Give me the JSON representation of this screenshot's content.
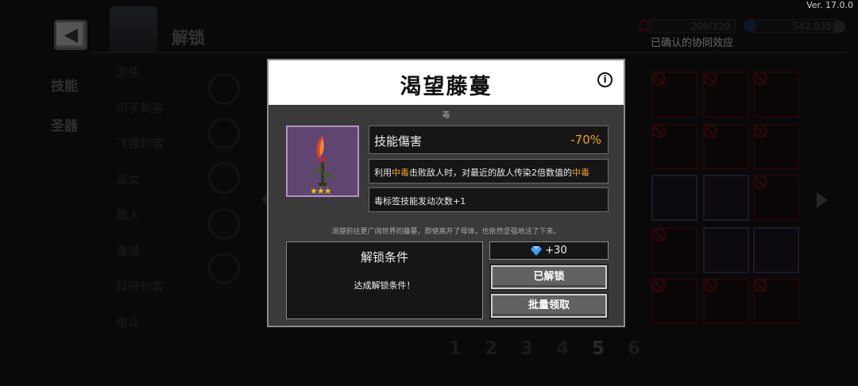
{
  "version": "Ver. 17.0.0",
  "header": {
    "title": "解锁",
    "resource_left": "209/320",
    "resource_right": "542,035",
    "synergy_label": "已确认的协同效应"
  },
  "sidebar": {
    "tabs": [
      {
        "label": "技能"
      },
      {
        "label": "圣器"
      }
    ]
  },
  "characters": [
    {
      "label": "游侠"
    },
    {
      "label": "爪子刺客"
    },
    {
      "label": "飞镖刺客"
    },
    {
      "label": "巫女"
    },
    {
      "label": "狼人"
    },
    {
      "label": "毒骑"
    },
    {
      "label": "科研刺客"
    },
    {
      "label": "电斗"
    }
  ],
  "skill_icons": [
    "auto-icon"
  ],
  "pager": {
    "pages": [
      "1",
      "2",
      "3",
      "4",
      "5",
      "6"
    ],
    "active": "5"
  },
  "modal": {
    "title": "渴望藤蔓",
    "tag": "毒",
    "item_stars": "★★★",
    "stat": {
      "name": "技能傷害",
      "value": "-70%"
    },
    "desc1": {
      "pre": "利用",
      "hl1": "中毒",
      "mid": "击败敌人时，对最近的敌人传染2倍数值的",
      "hl2": "中毒"
    },
    "desc2": "毒标签技能发动次数+1",
    "flavor": "渴望前往更广阔世界的藤蔓，即使离开了母体，也依然坚强地活了下来。",
    "condition_title": "解锁条件",
    "condition_text": "达成解锁条件！",
    "reward": "+30",
    "unlocked_button": "已解锁",
    "batch_button": "批量领取"
  },
  "colors": {
    "accent": "#f0a218",
    "item_bg": "#5e4670",
    "gem": "#3aa0ff"
  }
}
